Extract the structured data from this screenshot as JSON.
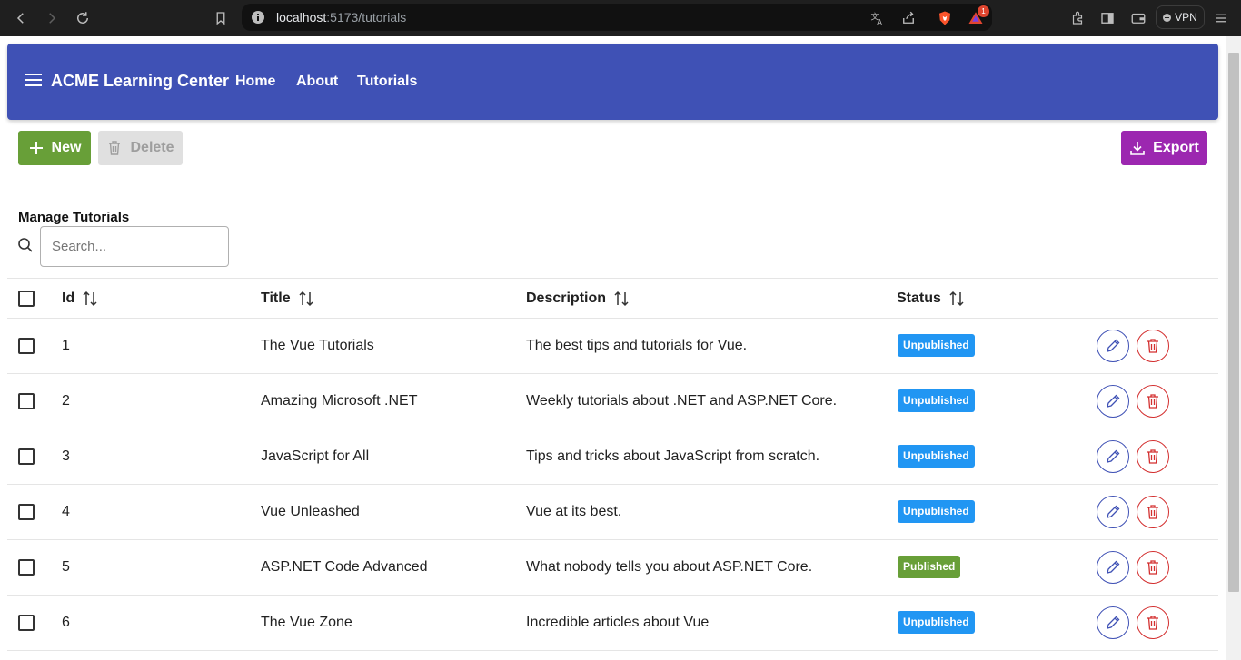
{
  "browser": {
    "url_host": "localhost",
    "url_path": ":5173/tutorials",
    "notification_count": "1",
    "vpn_label": "VPN"
  },
  "appbar": {
    "brand": "ACME Learning Center",
    "nav": [
      "Home",
      "About",
      "Tutorials"
    ]
  },
  "toolbar": {
    "new_label": "New",
    "delete_label": "Delete",
    "export_label": "Export"
  },
  "manage": {
    "title": "Manage Tutorials",
    "search_placeholder": "Search..."
  },
  "table": {
    "columns": [
      "Id",
      "Title",
      "Description",
      "Status"
    ],
    "rows": [
      {
        "id": "1",
        "title": "The Vue Tutorials",
        "description": "The best tips and tutorials for Vue.",
        "status": "Unpublished"
      },
      {
        "id": "2",
        "title": "Amazing Microsoft .NET",
        "description": "Weekly tutorials about .NET and ASP.NET Core.",
        "status": "Unpublished"
      },
      {
        "id": "3",
        "title": "JavaScript for All",
        "description": "Tips and tricks about JavaScript from scratch.",
        "status": "Unpublished"
      },
      {
        "id": "4",
        "title": "Vue Unleashed",
        "description": "Vue at its best.",
        "status": "Unpublished"
      },
      {
        "id": "5",
        "title": "ASP.NET Code Advanced",
        "description": "What nobody tells you about ASP.NET Core.",
        "status": "Published"
      },
      {
        "id": "6",
        "title": "The Vue Zone",
        "description": "Incredible articles about Vue",
        "status": "Unpublished"
      }
    ]
  },
  "colors": {
    "appbar": "#3f51b5",
    "new_button": "#689f38",
    "export_button": "#9c27b0",
    "unpublished": "#2196f3",
    "published": "#689f38",
    "edit_outline": "#3f51b5",
    "delete_outline": "#d32f2f"
  }
}
